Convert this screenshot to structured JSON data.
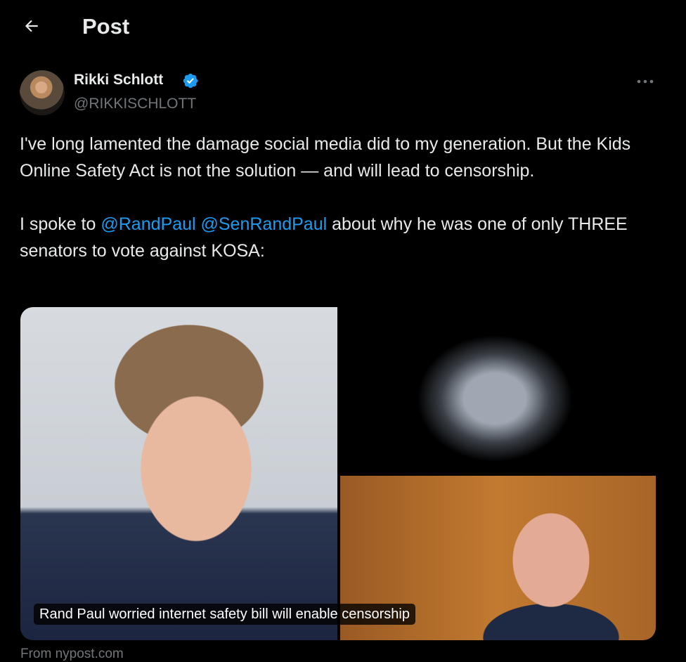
{
  "header": {
    "title": "Post",
    "back_icon": "arrow-left-icon"
  },
  "author": {
    "name": "Rikki Schlott",
    "handle": "@RIKKISCHLOTT",
    "verified": true,
    "verified_color": "#1d9bf0"
  },
  "post": {
    "paragraph1": "I've long lamented the damage social media did to my generation. But the Kids Online Safety Act is not the solution — and will lead to censorship.",
    "p2_before": "I spoke to ",
    "mention1": "@RandPaul",
    "p2_space": " ",
    "mention2": "@SenRandPaul",
    "p2_after": " about why he was one of only THREE senators to vote against KOSA:"
  },
  "card": {
    "caption": "Rand Paul worried internet safety bill will enable censorship",
    "source": "From nypost.com"
  },
  "colors": {
    "background": "#000000",
    "text": "#e7e9ea",
    "secondary": "#71767b",
    "link": "#1d9bf0"
  }
}
